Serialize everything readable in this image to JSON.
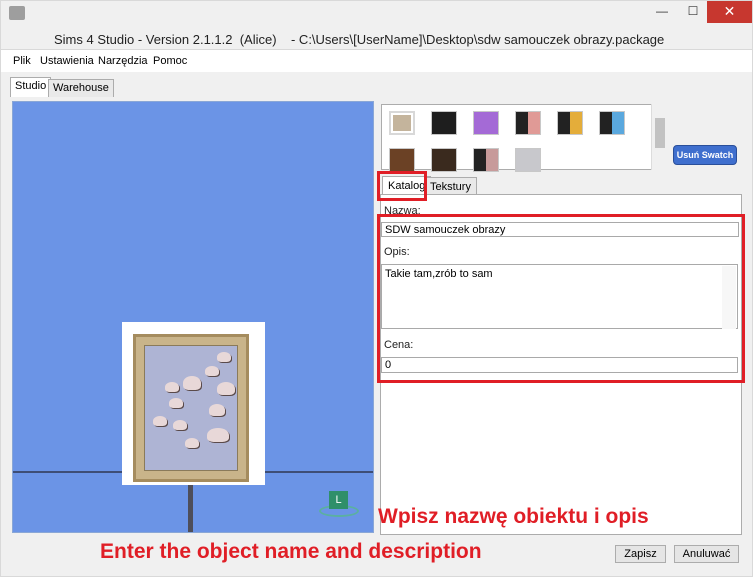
{
  "window": {
    "title": "Sims 4 Studio - Version 2.1.1.2  (Alice)    - C:\\Users\\[UserName]\\Desktop\\sdw samouczek obrazy.package",
    "minimize": "—",
    "maximize": "☐",
    "close": "✕"
  },
  "menu": [
    "Plik",
    "Ustawienia",
    "Narzędzia",
    "Pomoc"
  ],
  "outer_tabs": [
    "Studio",
    "Warehouse"
  ],
  "swatches": {
    "colors": [
      [
        "#c4b49c"
      ],
      [
        "#1e1e1e"
      ],
      [
        "#a46ad6"
      ],
      [
        "#222222",
        "#e09a96"
      ],
      [
        "#222222",
        "#e4ad3a"
      ],
      [
        "#222222",
        "#5aa8de"
      ],
      [
        "#6b4125"
      ],
      [
        "#3a2a1e"
      ],
      [
        "#222222",
        "#c79a9a"
      ],
      [
        "#c8c8cc"
      ]
    ],
    "remove_button": "Usuń Swatch"
  },
  "inner_tabs": [
    "Katalog",
    "Tekstury"
  ],
  "form": {
    "name_label": "Nazwa:",
    "name_value": "SDW samouczek obrazy",
    "desc_label": "Opis:",
    "desc_value": "Takie tam,zrób to sam",
    "price_label": "Cena:",
    "price_value": "0"
  },
  "viewport": {
    "badge": "L"
  },
  "captions": {
    "polish": "Wpisz nazwę obiektu i opis",
    "english": "Enter the object name and description"
  },
  "buttons": {
    "save": "Zapisz",
    "cancel": "Anuluwać"
  },
  "colors": {
    "highlight": "#e01e26",
    "viewport": "#6b94e6",
    "swatch_button": "#3f6fce"
  }
}
